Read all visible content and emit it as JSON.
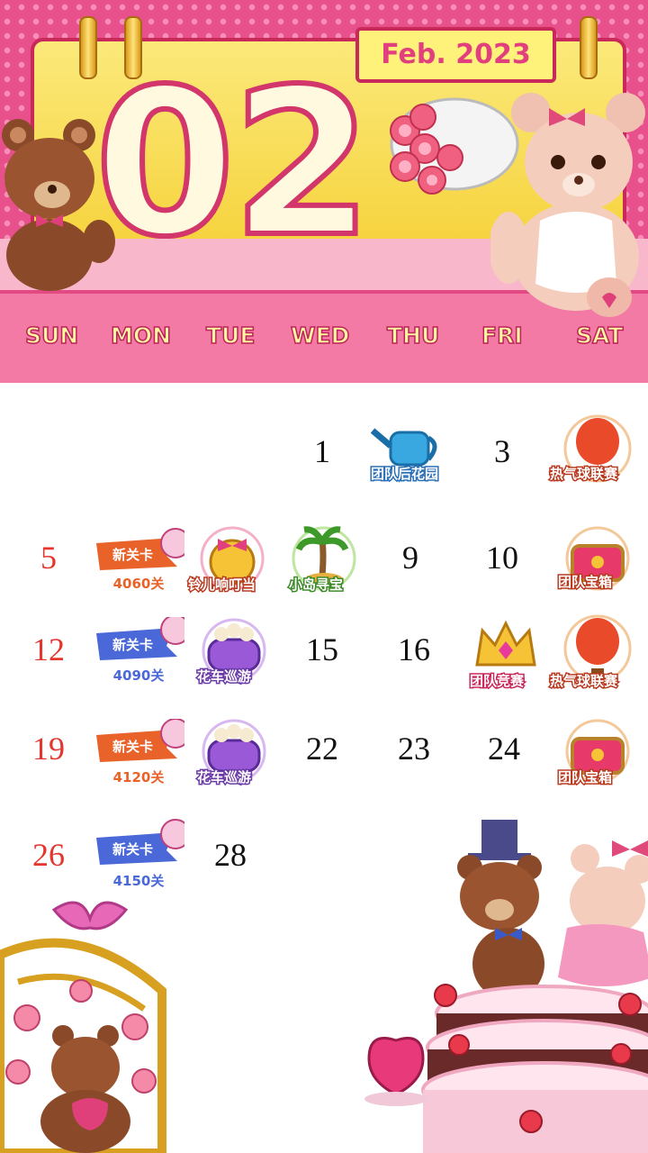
{
  "header": {
    "month_number": "02",
    "month_tag": "Feb. 2023",
    "weekdays": [
      "SUN",
      "MON",
      "TUE",
      "WED",
      "THU",
      "FRI",
      "SAT"
    ]
  },
  "colors": {
    "accent_pink": "#e8508c",
    "weekend_red": "#e5362e",
    "orange_badge": "#e8622a",
    "blue_badge": "#4a68d8"
  },
  "calendar": {
    "d1": "1",
    "d3": "3",
    "d5": "5",
    "d9": "9",
    "d10": "10",
    "d12": "12",
    "d15": "15",
    "d16": "16",
    "d19": "19",
    "d22": "22",
    "d23": "23",
    "d24": "24",
    "d26": "26",
    "d28": "28"
  },
  "events": {
    "e2": "团队后花园",
    "e4": "热气球联赛",
    "e7": "铃儿响叮当",
    "e8": "小岛寻宝",
    "e11": "团队宝箱",
    "e14": "花车巡游",
    "e17": "团队竞赛",
    "e18": "热气球联赛",
    "e21": "花车巡游",
    "e25": "团队宝箱"
  },
  "new_levels": {
    "title": "新关卡",
    "w1": "4060关",
    "w2": "4090关",
    "w3": "4120关",
    "w4": "4150关"
  }
}
